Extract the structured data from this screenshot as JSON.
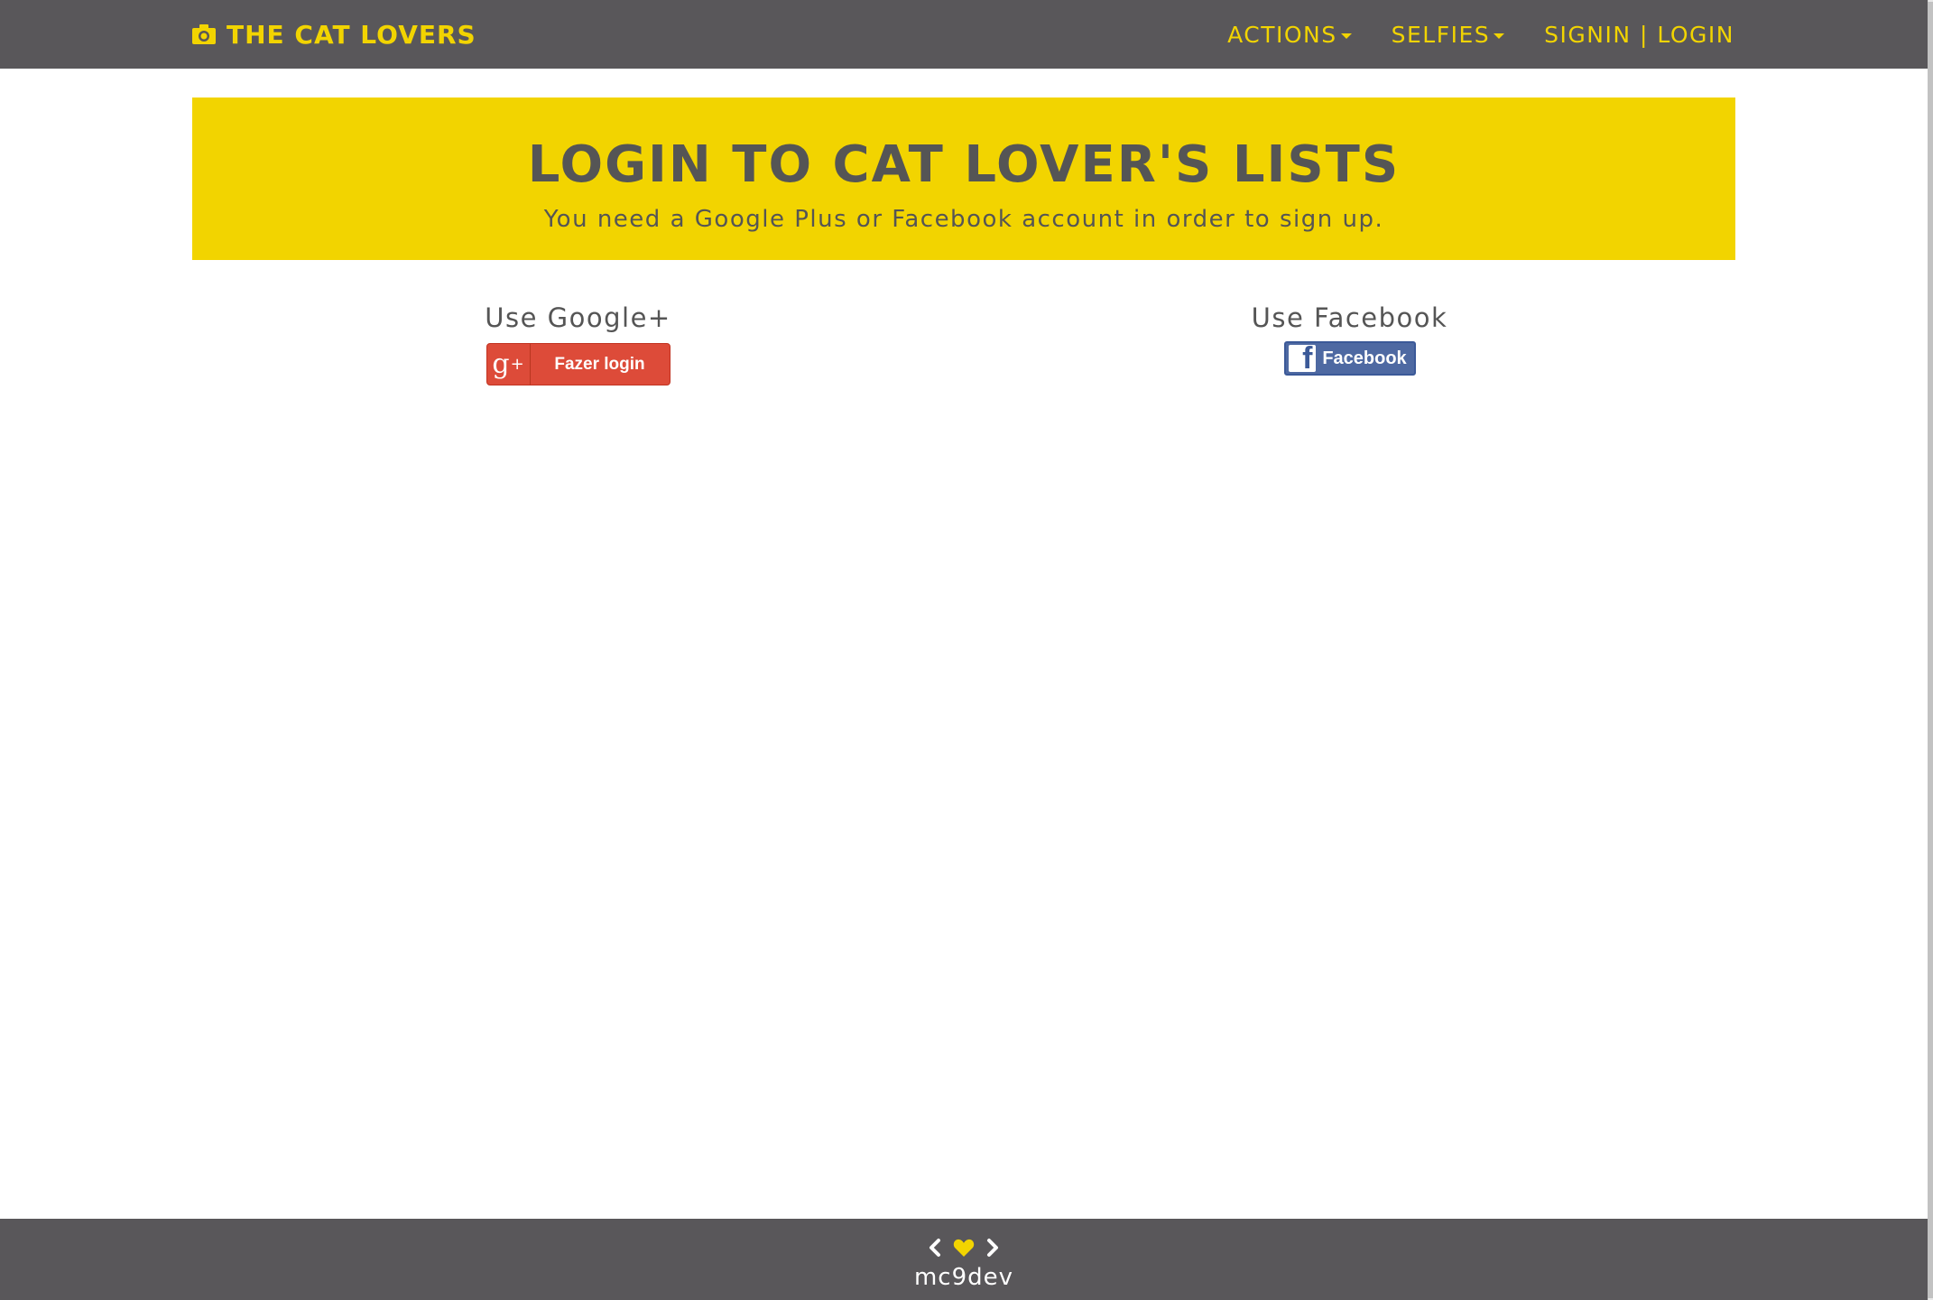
{
  "navbar": {
    "brand": "THE CAT LOVERS",
    "brand_icon": "camera-icon",
    "links": [
      {
        "label": "ACTIONS",
        "dropdown": true
      },
      {
        "label": "SELFIES",
        "dropdown": true
      },
      {
        "label": "SIGNIN | LOGIN",
        "dropdown": false
      }
    ]
  },
  "jumbotron": {
    "title": "LOGIN TO CAT LOVER'S LISTS",
    "subtitle": "You need a Google Plus or Facebook account in order to sign up."
  },
  "login": {
    "google": {
      "heading": "Use Google+",
      "icon_text": "g",
      "icon_plus": "+",
      "button_label": "Fazer login"
    },
    "facebook": {
      "heading": "Use Facebook",
      "icon_text": "f",
      "button_label": "Facebook"
    }
  },
  "footer": {
    "icons": [
      "chevron-left-icon",
      "heart-icon",
      "chevron-right-icon"
    ],
    "credit": "mc9dev"
  },
  "colors": {
    "accent": "#f2d400",
    "navbar_bg": "#59575a",
    "text": "#555555",
    "google_red": "#dd4b39",
    "facebook_blue": "#4e69a2"
  }
}
